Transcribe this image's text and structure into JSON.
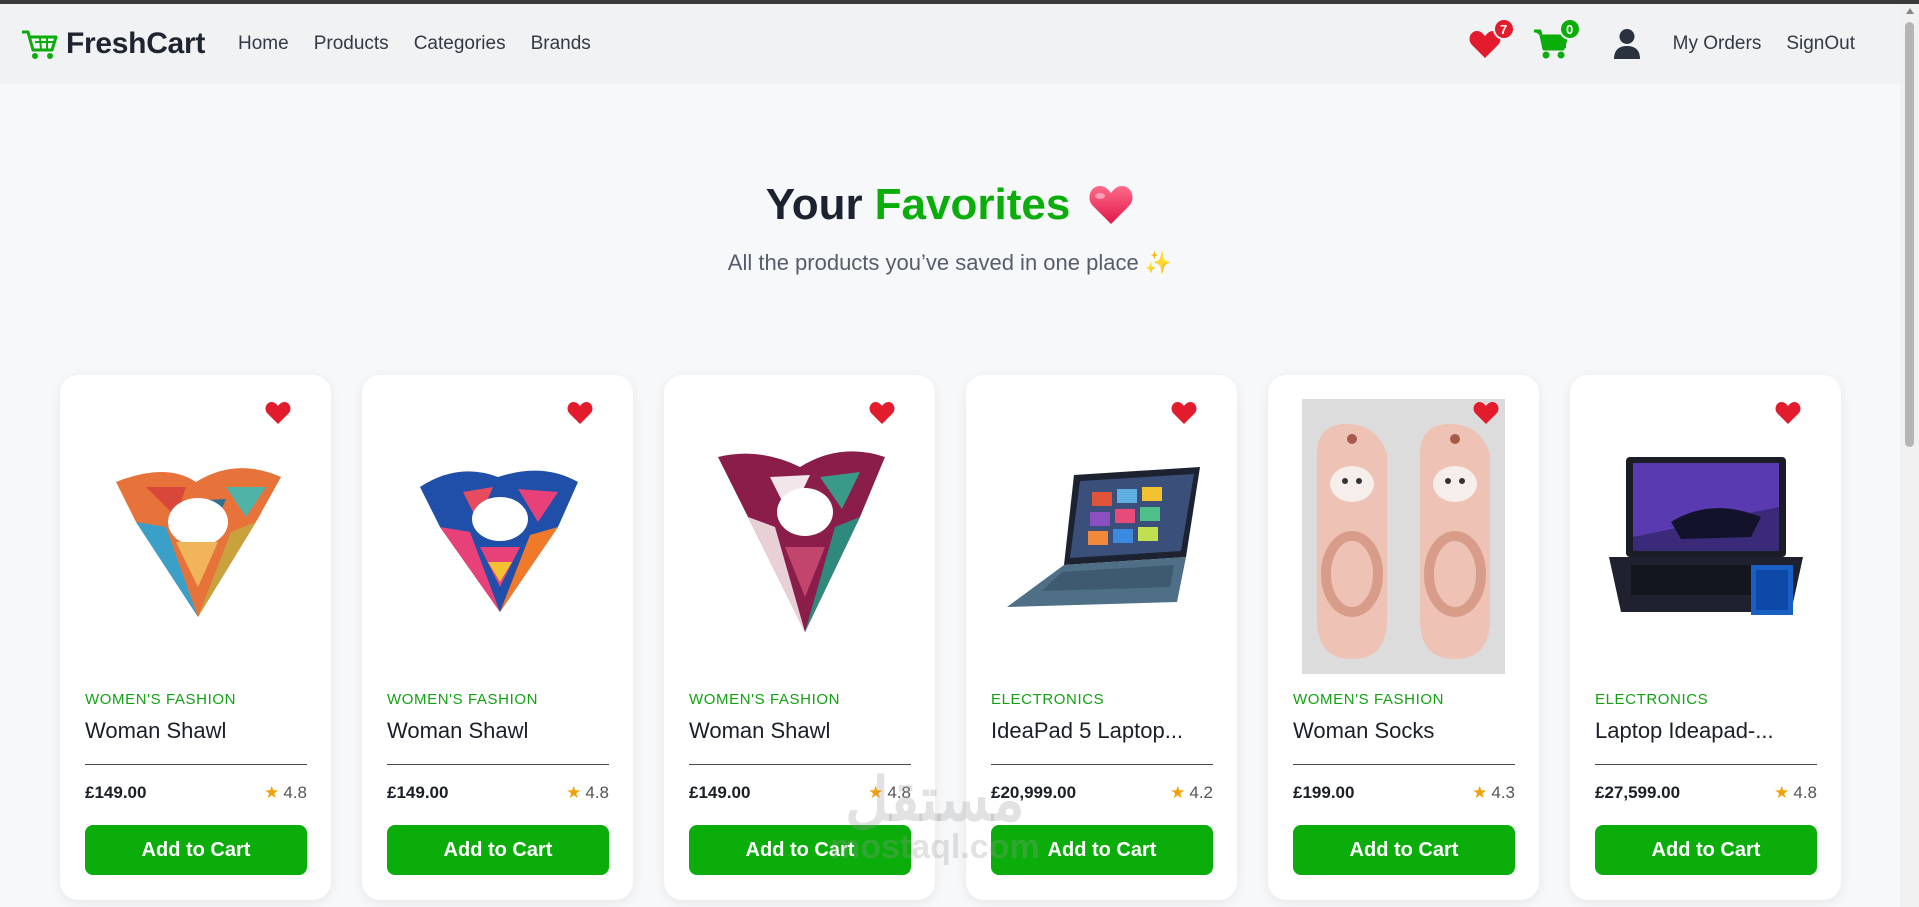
{
  "app": {
    "brand": "FreshCart",
    "brand_color": "#0aad0a"
  },
  "nav": {
    "links": [
      "Home",
      "Products",
      "Categories",
      "Brands"
    ],
    "wishlist_count": "7",
    "cart_count": "0",
    "my_orders": "My Orders",
    "signout": "SignOut"
  },
  "hero": {
    "title_part1": "Your",
    "title_part2": "Favorites",
    "subtitle": "All the products you’ve saved in one place ✨"
  },
  "products": [
    {
      "category": "WOMEN'S FASHION",
      "name": "Woman Shawl",
      "price": "£149.00",
      "rating": "4.8",
      "image": "scarf-orange-icon",
      "button": "Add to Cart"
    },
    {
      "category": "WOMEN'S FASHION",
      "name": "Woman Shawl",
      "price": "£149.00",
      "rating": "4.8",
      "image": "scarf-blue-pink-icon",
      "button": "Add to Cart"
    },
    {
      "category": "WOMEN'S FASHION",
      "name": "Woman Shawl",
      "price": "£149.00",
      "rating": "4.8",
      "image": "scarf-burgundy-icon",
      "button": "Add to Cart"
    },
    {
      "category": "ELECTRONICS",
      "name": "IdeaPad 5 Laptop...",
      "price": "£20,999.00",
      "rating": "4.2",
      "image": "laptop-blue-icon",
      "button": "Add to Cart"
    },
    {
      "category": "WOMEN'S FASHION",
      "name": "Woman Socks",
      "price": "£199.00",
      "rating": "4.3",
      "image": "socks-pink-icon",
      "button": "Add to Cart"
    },
    {
      "category": "ELECTRONICS",
      "name": "Laptop Ideapad-...",
      "price": "£27,599.00",
      "rating": "4.8",
      "image": "laptop-gaming-icon",
      "button": "Add to Cart"
    }
  ],
  "watermark": {
    "arabic": "مستقل",
    "latin": "mostaql.com"
  }
}
